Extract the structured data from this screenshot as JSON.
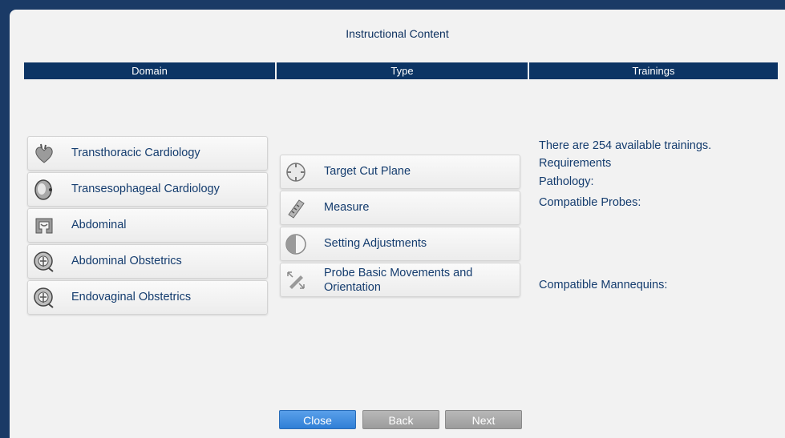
{
  "dialog": {
    "title": "Instructional Content"
  },
  "columns": {
    "domain": "Domain",
    "type": "Type",
    "trainings": "Trainings"
  },
  "domains": [
    {
      "label": "Transthoracic Cardiology",
      "icon": "heart-icon"
    },
    {
      "label": "Transesophageal Cardiology",
      "icon": "heart-cross-section-icon"
    },
    {
      "label": "Abdominal",
      "icon": "intestine-icon"
    },
    {
      "label": "Abdominal Obstetrics",
      "icon": "fetus-icon"
    },
    {
      "label": "Endovaginal Obstetrics",
      "icon": "fetus-icon"
    }
  ],
  "types": [
    {
      "label": "Target Cut Plane",
      "icon": "target-icon"
    },
    {
      "label": "Measure",
      "icon": "ruler-icon"
    },
    {
      "label": "Setting Adjustments",
      "icon": "contrast-icon"
    },
    {
      "label_line1": "Probe Basic Movements and",
      "label_line2": "Orientation",
      "icon": "probe-arrows-icon"
    }
  ],
  "trainings": {
    "available": "There are 254 available trainings.",
    "requirements": "Requirements",
    "pathology": "Pathology:",
    "probes": "Compatible Probes:",
    "mannequins": "Compatible Mannequins:"
  },
  "footer": {
    "close": "Close",
    "back": "Back",
    "next": "Next"
  },
  "colors": {
    "header_bg": "#0c3464",
    "text": "#143c6e",
    "close_button": "#3f8ee0",
    "disabled_button": "#a6a6a6"
  }
}
